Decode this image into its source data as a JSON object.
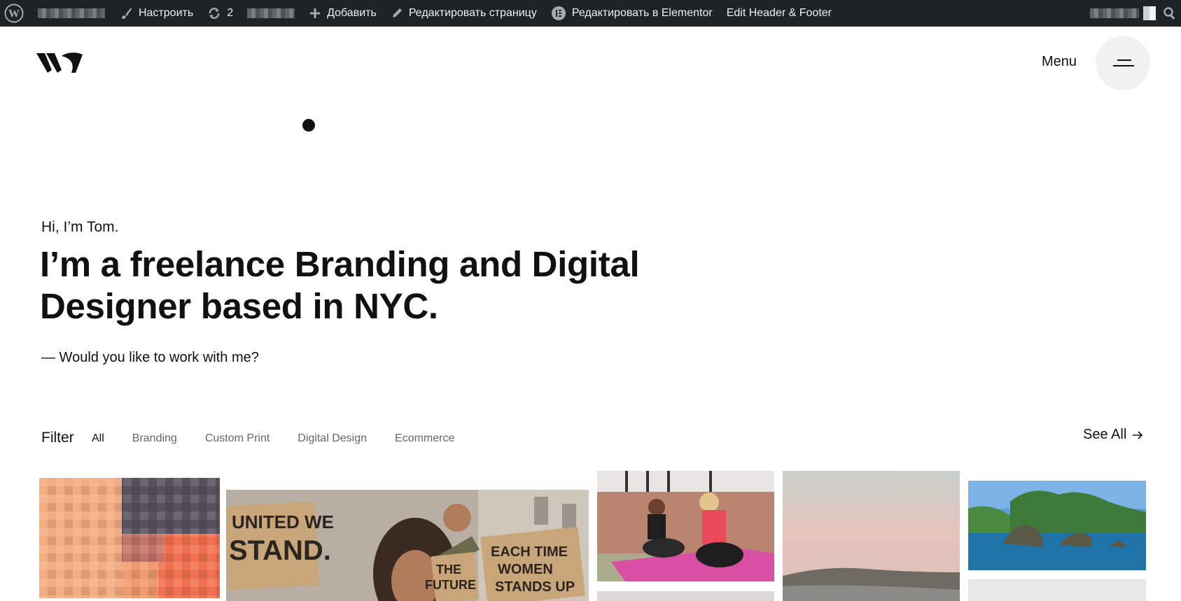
{
  "admin_bar": {
    "customize_label": "Настроить",
    "updates_count": "2",
    "add_label": "Добавить",
    "edit_page_label": "Редактировать страницу",
    "edit_elementor_label": "Редактировать в Elementor",
    "edit_header_footer_label": "Edit Header & Footer",
    "icons": [
      "wordpress-logo-icon",
      "paintbrush-icon",
      "refresh-icon",
      "plus-icon",
      "pencil-icon",
      "elementor-icon",
      "search-icon"
    ]
  },
  "header": {
    "menu_label": "Menu",
    "icons": [
      "site-logo-w",
      "hamburger-icon"
    ]
  },
  "hero": {
    "greeting": "Hi, I’m Tom.",
    "headline": "I’m a freelance Branding and Digital Designer based in NYC.",
    "cta": "— Would you like to work with me?"
  },
  "filter": {
    "label": "Filter",
    "tabs": [
      {
        "label": "All",
        "active": true
      },
      {
        "label": "Branding",
        "active": false
      },
      {
        "label": "Custom Print",
        "active": false
      },
      {
        "label": "Digital Design",
        "active": false
      },
      {
        "label": "Ecommerce",
        "active": false
      }
    ],
    "see_all_label": "See All"
  },
  "portfolio": {
    "items": [
      {
        "name": "pixelated-orange-tile"
      },
      {
        "name": "protest-sign-photo",
        "sign_texts": [
          "UNITED WE",
          "STAND.",
          "THE",
          "FUTURE",
          "EACH TIME",
          "WOMEN",
          "STANDS UP"
        ]
      },
      {
        "name": "yoga-women-photo"
      },
      {
        "name": "beach-sunset-photo"
      },
      {
        "name": "rocky-islands-photo"
      }
    ]
  },
  "colors": {
    "admin_bar_bg": "#1d2327",
    "admin_bar_text": "#f0f0f1",
    "text_primary": "#111111",
    "text_muted": "#666666",
    "menu_button_bg": "#f1f1f1"
  }
}
